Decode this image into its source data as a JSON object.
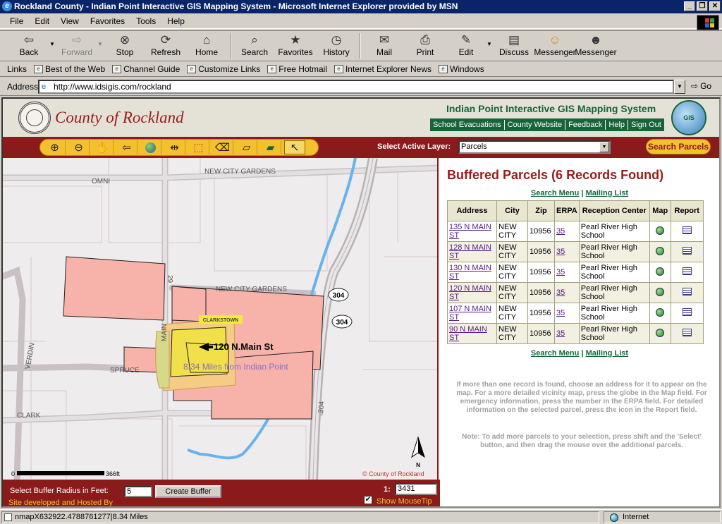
{
  "window": {
    "title": "Rockland County - Indian Point Interactive GIS Mapping System - Microsoft Internet Explorer provided by MSN"
  },
  "menu": [
    "File",
    "Edit",
    "View",
    "Favorites",
    "Tools",
    "Help"
  ],
  "toolbar": [
    {
      "label": "Back",
      "icon": "back-arrow-icon",
      "disabled": false
    },
    {
      "label": "Forward",
      "icon": "forward-arrow-icon",
      "disabled": true
    },
    {
      "label": "Stop",
      "icon": "stop-icon",
      "disabled": false
    },
    {
      "label": "Refresh",
      "icon": "refresh-icon",
      "disabled": false
    },
    {
      "label": "Home",
      "icon": "home-icon",
      "disabled": false
    },
    {
      "label": "Search",
      "icon": "search-icon",
      "disabled": false
    },
    {
      "label": "Favorites",
      "icon": "favorites-icon",
      "disabled": false
    },
    {
      "label": "History",
      "icon": "history-icon",
      "disabled": false
    },
    {
      "label": "Mail",
      "icon": "mail-icon",
      "disabled": false
    },
    {
      "label": "Print",
      "icon": "print-icon",
      "disabled": false
    },
    {
      "label": "Edit",
      "icon": "edit-icon",
      "disabled": false
    },
    {
      "label": "Discuss",
      "icon": "discuss-icon",
      "disabled": false
    },
    {
      "label": "Messenger",
      "icon": "messenger-icon",
      "disabled": false
    },
    {
      "label": "Messenger",
      "icon": "messenger-icon",
      "disabled": false
    }
  ],
  "links": {
    "label": "Links",
    "items": [
      "Best of the Web",
      "Channel Guide",
      "Customize Links",
      "Free Hotmail",
      "Internet Explorer News",
      "Windows"
    ]
  },
  "address": {
    "label": "Address",
    "url": "http://www.idsigis.com/rockland",
    "go": "Go"
  },
  "site": {
    "county_name": "County of Rockland",
    "app_title": "Indian Point Interactive GIS Mapping System",
    "nav": [
      "School Evacuations",
      "County Website",
      "Feedback",
      "Help",
      "Sign Out"
    ],
    "logo_text": "GIS"
  },
  "maptools": {
    "icons": [
      "zoom-in-icon",
      "zoom-out-icon",
      "pan-hand-icon",
      "back-extent-icon",
      "globe-full-extent-icon",
      "measure-icon",
      "select-icon",
      "eraser-icon",
      "layers-icon",
      "buffer-icon",
      "pointer-icon"
    ],
    "selected_index": 10,
    "active_layer_label": "Select Active Layer:",
    "active_layer_value": "Parcels",
    "search_button": "Search Parcels"
  },
  "map": {
    "streets": [
      "NEW CITY GARDENS",
      "OMNI",
      "NEW CITY GARDENS",
      "MAIN",
      "29",
      "VERDIN",
      "SPRUCE",
      "CLARK",
      "304"
    ],
    "route_shields": [
      "304",
      "304"
    ],
    "town_label": "CLARKSTOWN",
    "callout": "120 N.Main St",
    "distance": "8.34 Miles from Indian Point",
    "scale_start": "0",
    "scale_end": "366ft",
    "copyright": "© County of Rockland",
    "north": "N"
  },
  "results": {
    "title": "Buffered Parcels (6 Records Found)",
    "links": [
      "Search Menu",
      "Mailing List"
    ],
    "headers": [
      "Address",
      "City",
      "Zip",
      "ERPA",
      "Reception Center",
      "Map",
      "Report"
    ],
    "rows": [
      {
        "address": "135 N MAIN ST",
        "city": "NEW CITY",
        "zip": "10956",
        "erpa": "35",
        "center": "Pearl River High School"
      },
      {
        "address": "128 N MAIN ST",
        "city": "NEW CITY",
        "zip": "10956",
        "erpa": "35",
        "center": "Pearl River High School"
      },
      {
        "address": "130 N MAIN ST",
        "city": "NEW CITY",
        "zip": "10956",
        "erpa": "35",
        "center": "Pearl River High School"
      },
      {
        "address": "120 N MAIN ST",
        "city": "NEW CITY",
        "zip": "10956",
        "erpa": "35",
        "center": "Pearl River High School"
      },
      {
        "address": "107 N MAIN ST",
        "city": "NEW CITY",
        "zip": "10956",
        "erpa": "35",
        "center": "Pearl River High School"
      },
      {
        "address": "90 N MAIN ST",
        "city": "NEW CITY",
        "zip": "10956",
        "erpa": "35",
        "center": "Pearl River High School"
      }
    ],
    "help": "If more than one record is found, choose an address for it to appear on the map. For a more detailed vicinity map, press the globe in the Map field. For emergency information, press the number in the ERPA field. For detailed information on the selected parcel, press the icon in the Report field.",
    "note": "Note: To add more parcels to your selection, press shift and the 'Select' button, and then drag the mouse over the additional parcels."
  },
  "bottom": {
    "buffer_label": "Select Buffer Radius in Feet:",
    "buffer_value": "5",
    "buffer_button": "Create Buffer",
    "site_dev": "Site developed and Hosted By",
    "scale_label": "1:",
    "scale_value": "3431",
    "mousetip_label": "Show MouseTip",
    "mousetip_checked": true
  },
  "status": {
    "text": "nmapX632922.4788761277|8.34 Miles",
    "zone": "Internet"
  },
  "colors": {
    "parcel": "#f7b3aa",
    "selected": "#f1e04a",
    "buffer": "#f5cc86",
    "maroon": "#8b1a1a",
    "green": "#17643a"
  }
}
